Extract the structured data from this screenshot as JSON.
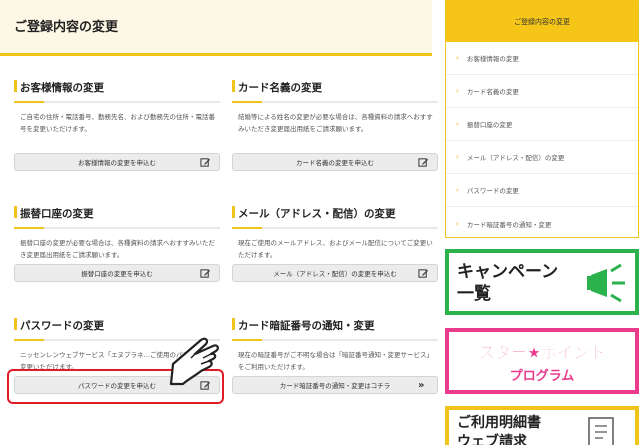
{
  "header": {
    "title": "ご登録内容の変更"
  },
  "sections": [
    {
      "title": "お客様情報の変更",
      "desc": "ご自宅の住所・電話番号、勤務先名、および勤務先の住所・電話番号を変更いただけます。",
      "button": "お客様情報の変更を申込む",
      "icon": "edit-icon"
    },
    {
      "title": "カード名義の変更",
      "desc": "結婚等による姓名の変更が必要な場合は、各種資料の請求へおすすみいただき変更届出用紙をご請求願います。",
      "button": "カード名義の変更を申込む",
      "icon": "edit-icon"
    },
    {
      "title": "振替口座の変更",
      "desc": "振替口座の変更が必要な場合は、各種資料の請求へおすすみいただき変更届出用紙をご請求願います。",
      "button": "振替口座の変更を申込む",
      "icon": "edit-icon"
    },
    {
      "title": "メール（アドレス・配信）の変更",
      "desc": "現在ご使用のメールアドレス、およびメール配信についてご変更いただけます。",
      "button": "メール（アドレス・配信）の変更を申込む",
      "icon": "edit-icon"
    },
    {
      "title": "パスワードの変更",
      "desc": "ニッセンレンウェブサービス「エヌプラネ…ご使用のパスワードを変更いただけます。",
      "button": "パスワードの変更を申込む",
      "icon": "edit-icon"
    },
    {
      "title": "カード暗証番号の通知・変更",
      "desc": "現在の暗証番号がご不明な場合は「暗証番号通知・変更サービス」をご利用いただけます。",
      "button": "カード暗証番号の通知・変更はコチラ",
      "icon": "double-chevron-right-icon"
    }
  ],
  "sidebar": {
    "title": "ご登録内容の変更",
    "items": [
      {
        "label": "お客様情報の変更"
      },
      {
        "label": "カード名義の変更"
      },
      {
        "label": "振替口座の変更"
      },
      {
        "label": "メール（アドレス・配信）の変更"
      },
      {
        "label": "パスワードの変更"
      },
      {
        "label": "カード暗証番号の通知・変更"
      }
    ]
  },
  "banners": {
    "campaign": {
      "text_line1": "キャンペーン",
      "text_line2": "一覧"
    },
    "star": {
      "text_line1": "スター★ポイント",
      "text_line2": "プログラム"
    },
    "meisai": {
      "text_line1": "ご利用明細書",
      "text_line2": "ウェブ請求"
    }
  },
  "colors": {
    "accent": "#f0c419",
    "highlight": "#e01c24",
    "campaign": "#2bb24c",
    "star": "#ea3b8d"
  }
}
